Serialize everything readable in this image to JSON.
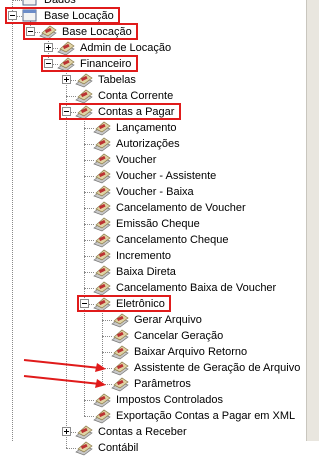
{
  "tree": {
    "items": [
      {
        "label": "Dados",
        "level": 0,
        "toggle": "none",
        "icon": "doc-icon"
      },
      {
        "label": "Base Locação",
        "level": 0,
        "toggle": "minus",
        "icon": "doc-icon",
        "highlighted": true
      },
      {
        "label": "Base Locação",
        "level": 1,
        "toggle": "minus",
        "icon": "module-icon",
        "highlighted": true
      },
      {
        "label": "Admin de Locação",
        "level": 2,
        "toggle": "plus",
        "icon": "module-icon"
      },
      {
        "label": "Financeiro",
        "level": 2,
        "toggle": "minus",
        "icon": "module-icon",
        "highlighted": true
      },
      {
        "label": "Tabelas",
        "level": 3,
        "toggle": "plus",
        "icon": "module-icon"
      },
      {
        "label": "Conta Corrente",
        "level": 3,
        "toggle": "none",
        "icon": "module-icon"
      },
      {
        "label": "Contas a Pagar",
        "level": 3,
        "toggle": "minus",
        "icon": "module-icon",
        "highlighted": true
      },
      {
        "label": "Lançamento",
        "level": 4,
        "toggle": "none",
        "icon": "module-icon"
      },
      {
        "label": "Autorizações",
        "level": 4,
        "toggle": "none",
        "icon": "module-icon"
      },
      {
        "label": "Voucher",
        "level": 4,
        "toggle": "none",
        "icon": "module-icon"
      },
      {
        "label": "Voucher - Assistente",
        "level": 4,
        "toggle": "none",
        "icon": "module-icon"
      },
      {
        "label": "Voucher - Baixa",
        "level": 4,
        "toggle": "none",
        "icon": "module-icon"
      },
      {
        "label": "Cancelamento de Voucher",
        "level": 4,
        "toggle": "none",
        "icon": "module-icon"
      },
      {
        "label": "Emissão Cheque",
        "level": 4,
        "toggle": "none",
        "icon": "module-icon"
      },
      {
        "label": "Cancelamento Cheque",
        "level": 4,
        "toggle": "none",
        "icon": "module-icon"
      },
      {
        "label": "Incremento",
        "level": 4,
        "toggle": "none",
        "icon": "module-icon"
      },
      {
        "label": "Baixa Direta",
        "level": 4,
        "toggle": "none",
        "icon": "module-icon"
      },
      {
        "label": "Cancelamento Baixa de Voucher",
        "level": 4,
        "toggle": "none",
        "icon": "module-icon"
      },
      {
        "label": "Eletrônico",
        "level": 4,
        "toggle": "minus",
        "icon": "module-icon",
        "highlighted": true
      },
      {
        "label": "Gerar Arquivo",
        "level": 5,
        "toggle": "none",
        "icon": "module-icon"
      },
      {
        "label": "Cancelar Geração",
        "level": 5,
        "toggle": "none",
        "icon": "module-icon"
      },
      {
        "label": "Baixar Arquivo Retorno",
        "level": 5,
        "toggle": "none",
        "icon": "module-icon"
      },
      {
        "label": "Assistente de Geração de Arquivo",
        "level": 5,
        "toggle": "none",
        "icon": "module-icon",
        "arrow": true
      },
      {
        "label": "Parâmetros",
        "level": 5,
        "toggle": "none",
        "icon": "module-icon",
        "arrow": true
      },
      {
        "label": "Impostos Controlados",
        "level": 4,
        "toggle": "none",
        "icon": "module-icon"
      },
      {
        "label": "Exportação Contas a Pagar em XML",
        "level": 4,
        "toggle": "none",
        "icon": "module-icon"
      },
      {
        "label": "Contas a Receber",
        "level": 3,
        "toggle": "plus",
        "icon": "module-icon"
      },
      {
        "label": "Contábil",
        "level": 3,
        "toggle": "none",
        "icon": "module-icon"
      }
    ]
  },
  "colors": {
    "highlight": "#e01b1b",
    "guide": "#8a8a8a",
    "scrollbar": "#e9e6df"
  }
}
